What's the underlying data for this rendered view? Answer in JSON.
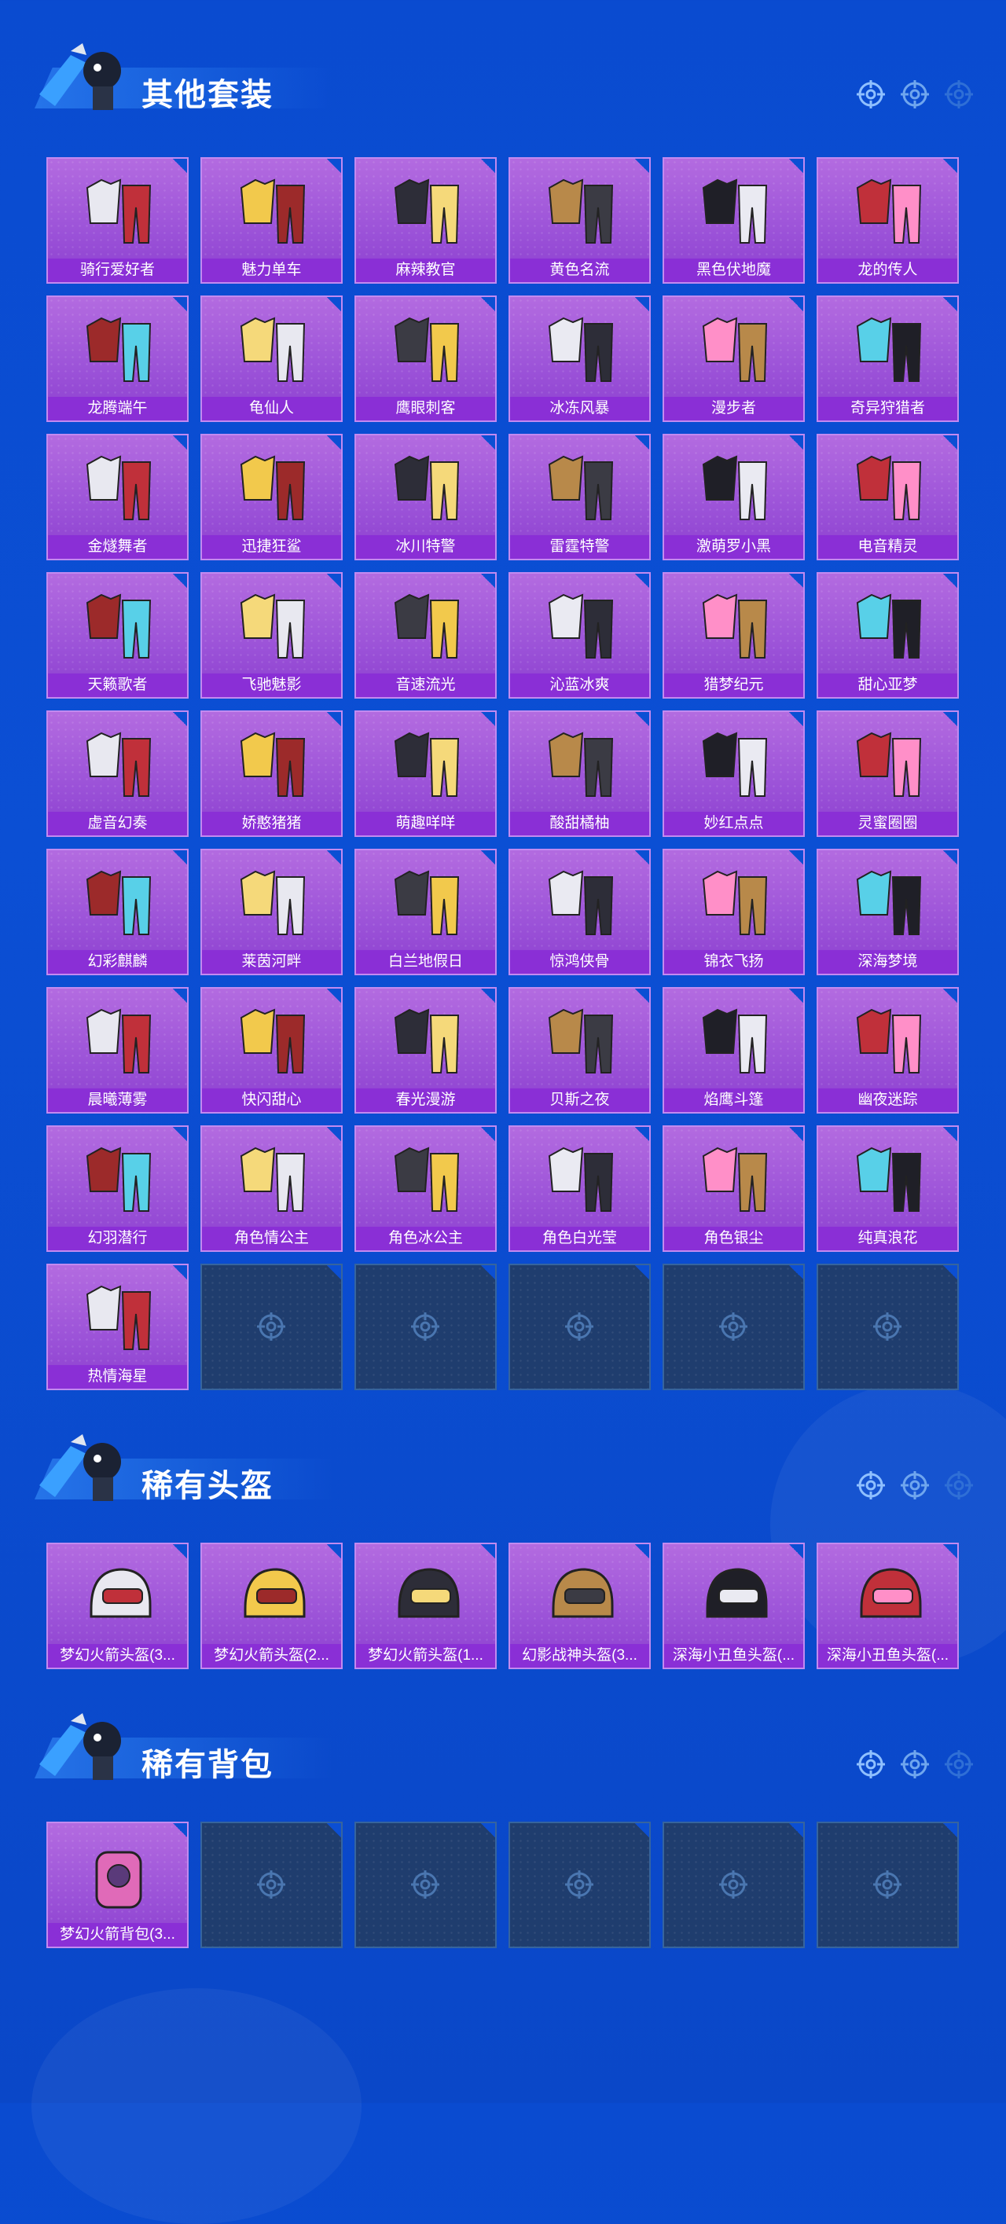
{
  "colors": {
    "background": "#0b4fd4",
    "card": "#9b52d8",
    "card_label": "#8a2fd6",
    "empty_slot": "#1f3d6e"
  },
  "sections": {
    "outfits": {
      "title": "其他套装",
      "items": [
        "骑行爱好者",
        "魅力单车",
        "麻辣教官",
        "黄色名流",
        "黑色伏地魔",
        "龙的传人",
        "龙腾端午",
        "龟仙人",
        "鹰眼刺客",
        "冰冻风暴",
        "漫步者",
        "奇异狩猎者",
        "金燧舞者",
        "迅捷狂鲨",
        "冰川特警",
        "雷霆特警",
        "激萌罗小黑",
        "电音精灵",
        "天籁歌者",
        "飞驰魅影",
        "音速流光",
        "沁蓝冰爽",
        "猎梦纪元",
        "甜心亚梦",
        "虚音幻奏",
        "娇憨猪猪",
        "萌趣咩咩",
        "酸甜橘柚",
        "妙红点点",
        "灵蜜圈圈",
        "幻彩麒麟",
        "莱茵河畔",
        "白兰地假日",
        "惊鸿侠骨",
        "锦衣飞扬",
        "深海梦境",
        "晨曦薄雾",
        "快闪甜心",
        "春光漫游",
        "贝斯之夜",
        "焰鹰斗篷",
        "幽夜迷踪",
        "幻羽潜行",
        "角色情公主",
        "角色冰公主",
        "角色白光莹",
        "角色银尘",
        "纯真浪花",
        "热情海星"
      ],
      "empty_slots": 5
    },
    "helmets": {
      "title": "稀有头盔",
      "items": [
        "梦幻火箭头盔(3...",
        "梦幻火箭头盔(2...",
        "梦幻火箭头盔(1...",
        "幻影战神头盔(3...",
        "深海小丑鱼头盔(...",
        "深海小丑鱼头盔(..."
      ]
    },
    "backpacks": {
      "title": "稀有背包",
      "items": [
        "梦幻火箭背包(3..."
      ],
      "empty_slots": 5
    }
  },
  "icons": {
    "section_decoration": "crosshair-icon",
    "empty_slot": "crosshair-icon",
    "mascot": "mascot-icon"
  }
}
